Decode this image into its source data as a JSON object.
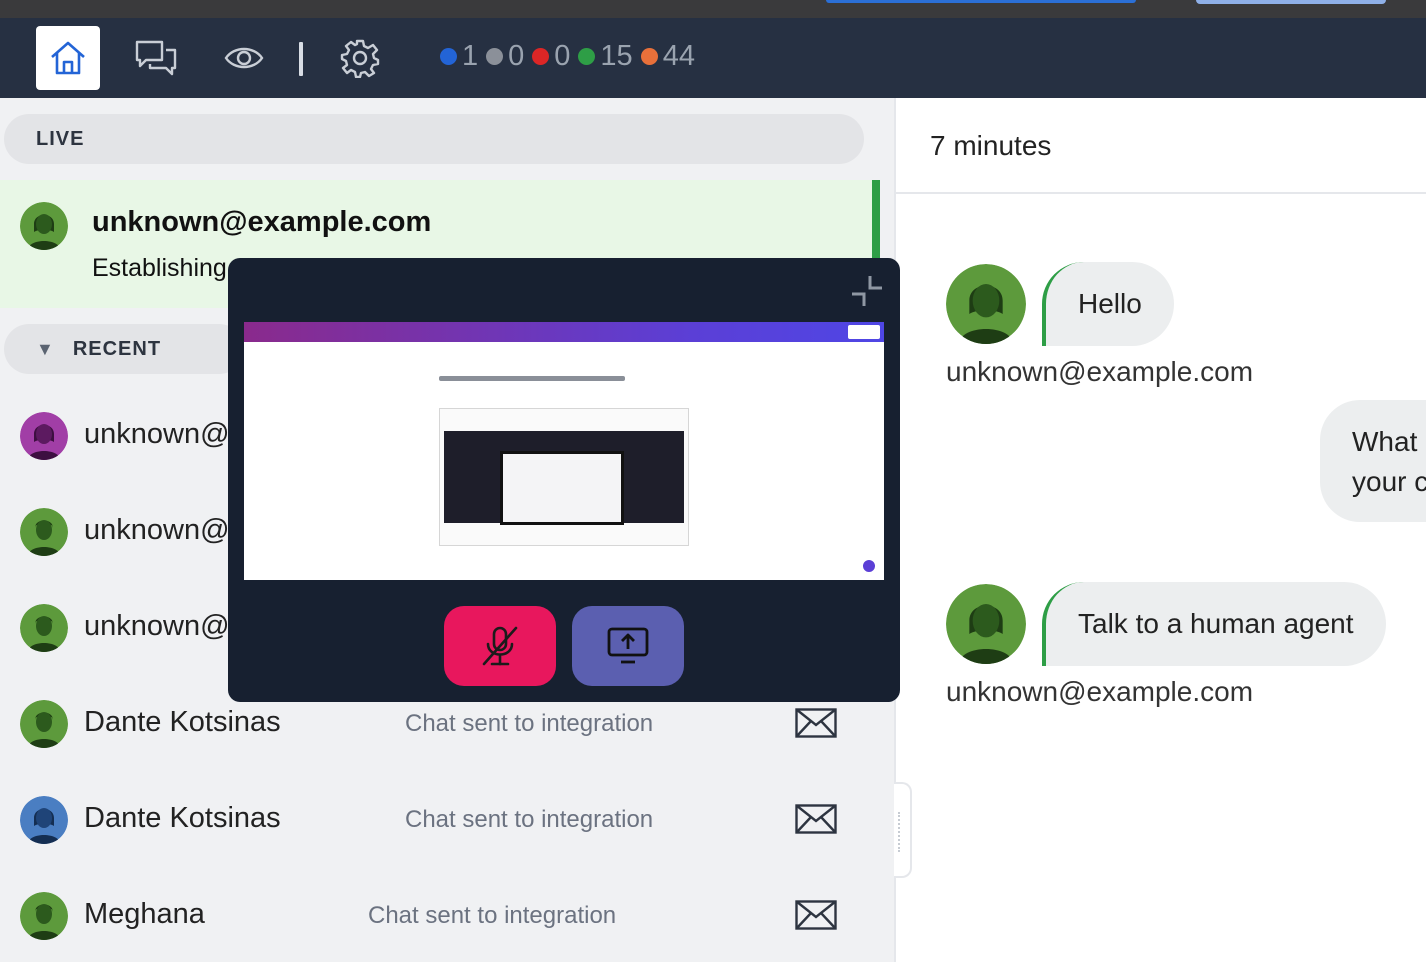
{
  "toolbar": {
    "counters": [
      {
        "color": "#2364d6",
        "value": "1"
      },
      {
        "color": "#8b9099",
        "value": "0"
      },
      {
        "color": "#dc2626",
        "value": "0"
      },
      {
        "color": "#2e9e46",
        "value": "15"
      },
      {
        "color": "#e8703a",
        "value": "44"
      }
    ]
  },
  "sections": {
    "live": "LIVE",
    "recent": "RECENT"
  },
  "live_chat": {
    "name": "unknown@example.com",
    "status": "Establishing"
  },
  "recent_chats": [
    {
      "name": "unknown@e",
      "status": "",
      "avatar_color": "#8a2a8c"
    },
    {
      "name": "unknown@e",
      "status": "",
      "avatar_color": "#3f7a2b"
    },
    {
      "name": "unknown@e",
      "status": "",
      "avatar_color": "#3f7a2b"
    },
    {
      "name": "Dante Kotsinas",
      "status": "Chat sent to integration",
      "avatar_color": "#3f7a2b"
    },
    {
      "name": "Dante Kotsinas",
      "status": "Chat sent to integration",
      "avatar_color": "#2f5fa0"
    },
    {
      "name": "Meghana",
      "status": "Chat sent to integration",
      "avatar_color": "#3f7a2b"
    }
  ],
  "conversation": {
    "duration": "7 minutes",
    "messages": [
      {
        "text": "Hello",
        "sender": "unknown@example.com"
      },
      {
        "text": "What\nyour c",
        "sender": ""
      },
      {
        "text": "Talk to a human agent",
        "sender": "unknown@example.com"
      }
    ]
  },
  "colors": {
    "toolbar_bg": "#263042",
    "live_green": "#2e9e46",
    "mute_red": "#e8175d",
    "share_purple": "#5b5fb0"
  }
}
